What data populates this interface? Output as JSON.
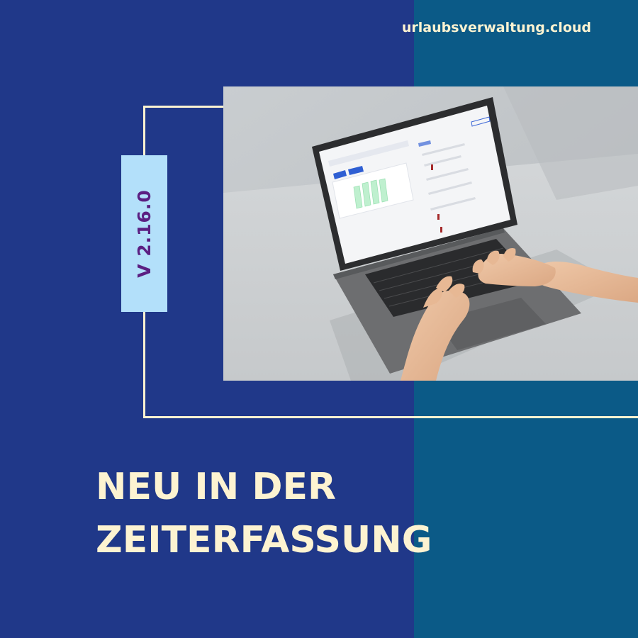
{
  "colors": {
    "left_background": "#203889",
    "right_background": "#0b5a87",
    "text_cream": "#fdf3d1",
    "badge_background": "#b3e0fa",
    "badge_text": "#5b1f82",
    "frame_line": "#fdf3d1"
  },
  "brand": {
    "text": "urlaubsverwaltung.cloud"
  },
  "version_badge": {
    "text": "V 2.16.0"
  },
  "headline": {
    "line1": "NEU IN DER",
    "line2": "ZEITERFASSUNG"
  },
  "photo": {
    "subject": "hands typing on a laptop showing a time tracking dashboard",
    "icon": "laptop-photo"
  }
}
